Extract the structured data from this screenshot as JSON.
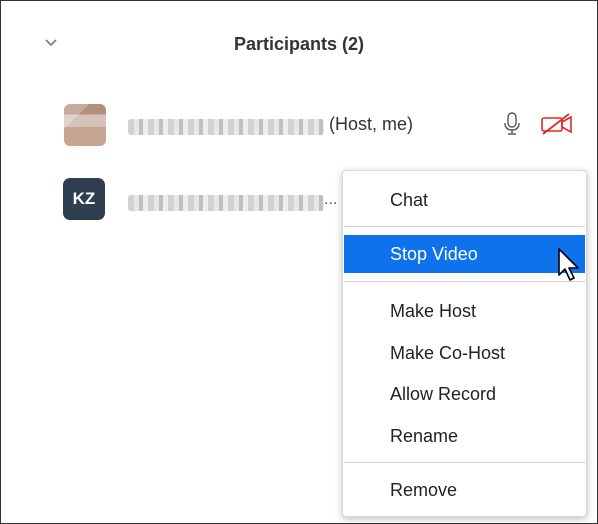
{
  "panel": {
    "title": "Participants (2)",
    "collapse_icon": "chevron-down-icon"
  },
  "participants": [
    {
      "name_obscured": true,
      "suffix": "(Host, me)",
      "avatar": "photo",
      "icons": [
        "microphone-icon",
        "video-off-icon"
      ],
      "video_off_color": "#e02828"
    },
    {
      "name_obscured": true,
      "initials": "KZ",
      "avatar": "initials",
      "truncation": "..."
    }
  ],
  "context_menu": {
    "items": [
      {
        "label": "Chat"
      },
      {
        "label": "Stop Video",
        "highlighted": true
      },
      {
        "label": "Make Host"
      },
      {
        "label": "Make Co-Host"
      },
      {
        "label": "Allow Record"
      },
      {
        "label": "Rename"
      },
      {
        "label": "Remove"
      }
    ],
    "highlight_color": "#0e72ed"
  },
  "pointer": "mouse-pointer-icon"
}
